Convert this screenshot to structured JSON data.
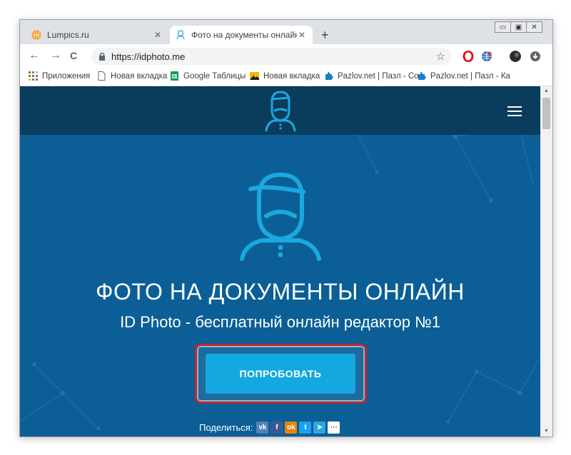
{
  "browser": {
    "tabs": [
      {
        "title": "Lumpics.ru",
        "favicon": "orange-ball-icon"
      },
      {
        "title": "Фото на документы онлайн: паспо",
        "favicon": "idphoto-icon",
        "active": true
      }
    ],
    "close_symbol": "✕",
    "new_tab_symbol": "+",
    "window_controls": [
      "▭",
      "▣",
      "✕"
    ]
  },
  "toolbar": {
    "back": "←",
    "forward": "→",
    "reload": "C",
    "url": "https://idphoto.me",
    "star": "☆"
  },
  "bookmarks": [
    {
      "label": "Приложения",
      "icon": "apps-grid-icon"
    },
    {
      "label": "Новая вкладка",
      "icon": "page-icon"
    },
    {
      "label": "Google Таблицы",
      "icon": "google-sheets-icon"
    },
    {
      "label": "Новая вкладка",
      "icon": "image-icon"
    },
    {
      "label": "Pazlov.net | Пазл - Со",
      "icon": "puzzle-icon"
    },
    {
      "label": "Pazlov.net | Пазл - Ка",
      "icon": "puzzle-icon"
    }
  ],
  "hero": {
    "title": "ФОТО НА ДОКУМЕНТЫ ОНЛАЙН",
    "subtitle": "ID Photo - бесплатный онлайн редактор №1",
    "cta": "ПОПРОБОВАТЬ"
  },
  "share": {
    "label": "Поделиться:",
    "icons": [
      {
        "name": "vk-icon",
        "glyph": "vk",
        "color": "#5181b8"
      },
      {
        "name": "facebook-icon",
        "glyph": "f",
        "color": "#3b5998"
      },
      {
        "name": "odnoklassniki-icon",
        "glyph": "ok",
        "color": "#ee8208"
      },
      {
        "name": "twitter-icon",
        "glyph": "t",
        "color": "#1da1f2"
      },
      {
        "name": "telegram-icon",
        "glyph": "➤",
        "color": "#2ca5e0"
      },
      {
        "name": "more-icon",
        "glyph": "···",
        "color": "#ffffff"
      }
    ]
  },
  "colors": {
    "site_bg": "#0b5f96",
    "header_bg": "#0a3c5c",
    "accent": "#14a8e0",
    "highlight": "#c1272d"
  }
}
